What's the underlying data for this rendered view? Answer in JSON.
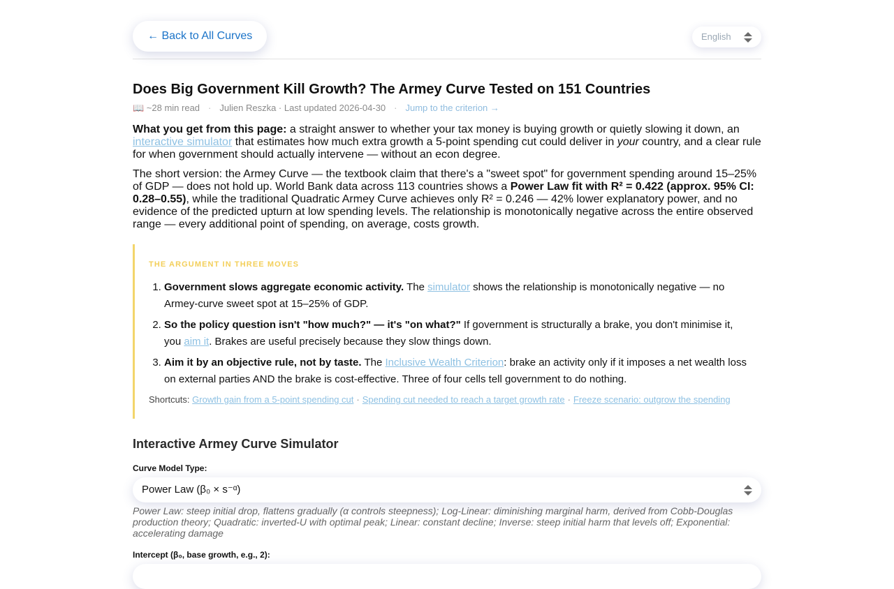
{
  "header": {
    "back_label": "← Back to All Curves",
    "language": "English"
  },
  "article": {
    "title": "Does Big Government Kill Growth? The Armey Curve Tested on 151 Countries",
    "read_time": "📖 ~28 min read",
    "author_updated": "Julien Reszka · Last updated 2026-04-30",
    "jump_link": "Jump to the criterion →"
  },
  "intro1": {
    "lead": "What you get from this page:",
    "t1": " a straight answer to whether your tax money is buying growth or quietly slowing it down, an ",
    "link": "interactive simulator",
    "t2": " that estimates how much extra growth a 5-point spending cut could deliver in ",
    "emph": "your",
    "t3": " country, and a clear rule for when government should actually intervene — without an econ degree."
  },
  "intro2": {
    "t1": "The short version: the Armey Curve — the textbook claim that there's a \"sweet spot\" for government spending around 15–25% of GDP — does not hold up. World Bank data across 113 countries shows a ",
    "bold": "Power Law fit with R² = 0.422 (approx. 95% CI: 0.28–0.55)",
    "t2": ", while the traditional Quadratic Armey Curve achieves only R² = 0.246 — 42% lower explanatory power, and no evidence of the predicted upturn at low spending levels. The relationship is monotonically negative across the entire observed range — every additional point of spending, on average, costs growth."
  },
  "argument": {
    "title": "THE ARGUMENT IN THREE MOVES",
    "m1_bold": "Government slows aggregate economic activity.",
    "m1_t1": " The ",
    "m1_link": "simulator",
    "m1_t2": " shows the relationship is monotonically negative — no Armey-curve sweet spot at 15–25% of GDP.",
    "m2_bold": "So the policy question isn't \"how much?\" — it's \"on what?\"",
    "m2_t1": " If government is structurally a brake, you don't minimise it, you ",
    "m2_link": "aim it",
    "m2_t2": ". Brakes are useful precisely because they slow things down.",
    "m3_bold": "Aim it by an objective rule, not by taste.",
    "m3_t1": " The ",
    "m3_link": "Inclusive Wealth Criterion",
    "m3_t2": ": brake an activity only if it imposes a net wealth loss on external parties AND the brake is cost-effective. Three of four cells tell government to do nothing.",
    "shortcuts_label": "Shortcuts:",
    "shortcut1": "Growth gain from a 5-point spending cut",
    "shortcut2": "Spending cut needed to reach a target growth rate",
    "shortcut3": "Freeze scenario: outgrow the spending",
    "separator": "·"
  },
  "simulator": {
    "heading": "Interactive Armey Curve Simulator",
    "model_label": "Curve Model Type:",
    "model_value": "Power Law (β₀ × s⁻ᵅ)",
    "model_hint": "Power Law: steep initial drop, flattens gradually (α controls steepness); Log-Linear: diminishing marginal harm, derived from Cobb-Douglas production theory; Quadratic: inverted-U with optimal peak; Linear: constant decline; Inverse: steep initial harm that levels off; Exponential: accelerating damage",
    "intercept_label": "Intercept (β₀, base growth, e.g., 2):"
  }
}
